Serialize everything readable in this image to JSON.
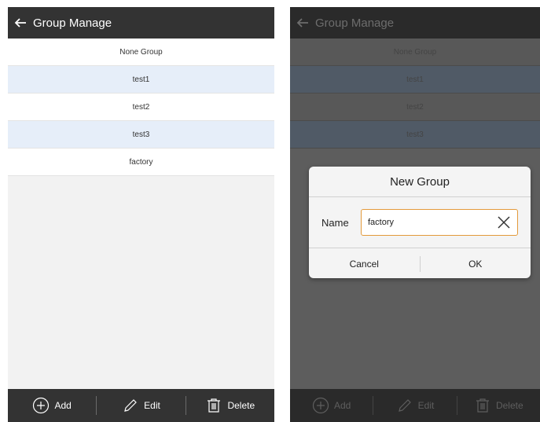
{
  "left": {
    "appbar": {
      "title": "Group Manage"
    },
    "groups": [
      "None Group",
      "test1",
      "test2",
      "test3",
      "factory"
    ],
    "toolbar": {
      "add_label": "Add",
      "edit_label": "Edit",
      "delete_label": "Delete"
    }
  },
  "right": {
    "appbar": {
      "title": "Group Manage"
    },
    "groups": [
      "None Group",
      "test1",
      "test2",
      "test3"
    ],
    "dialog": {
      "title": "New Group",
      "name_label": "Name",
      "name_value": "factory",
      "cancel_label": "Cancel",
      "ok_label": "OK"
    },
    "toolbar": {
      "add_label": "Add",
      "edit_label": "Edit",
      "delete_label": "Delete"
    }
  },
  "icons": {
    "back": "arrow-left-icon",
    "add": "plus-circle-icon",
    "edit": "pencil-icon",
    "delete": "trash-icon",
    "clear": "close-icon"
  },
  "colors": {
    "bar": "#333333",
    "row_alt": "#e6eef9",
    "input_border": "#e39a3b"
  }
}
